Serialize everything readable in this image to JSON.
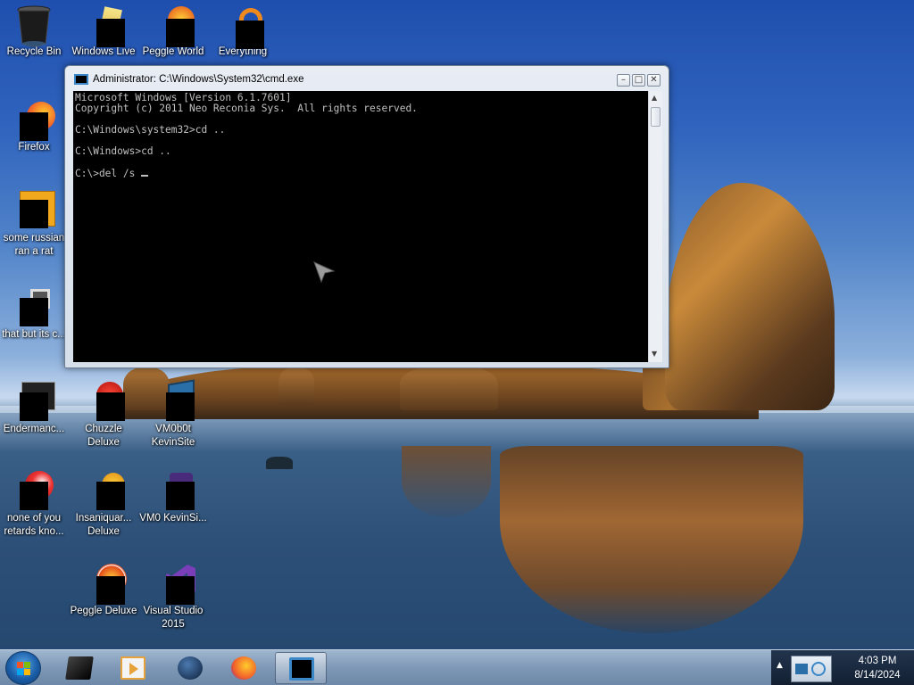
{
  "desktop": {
    "icons": [
      {
        "label": "Recycle Bin"
      },
      {
        "label": "Windows Live"
      },
      {
        "label": "Peggle World"
      },
      {
        "label": "Everything"
      },
      {
        "label": "Firefox"
      },
      {
        "label": "some russian ran a rat"
      },
      {
        "label": "that but its c..."
      },
      {
        "label": "Endermanc..."
      },
      {
        "label": "Chuzzle Deluxe"
      },
      {
        "label": "VM0b0t KevinSite"
      },
      {
        "label": "none of you retards kno..."
      },
      {
        "label": "Insaniquar... Deluxe"
      },
      {
        "label": "VM0 KevinSi..."
      },
      {
        "label": "Peggle Deluxe"
      },
      {
        "label": "Visual Studio 2015"
      }
    ]
  },
  "cmd_window": {
    "title": "Administrator: C:\\Windows\\System32\\cmd.exe",
    "lines": [
      "Microsoft Windows [Version 6.1.7601]",
      "Copyright (c) 2011 Neo Reconia Sys.  All rights reserved.",
      "",
      "C:\\Windows\\system32>cd ..",
      "",
      "C:\\Windows>cd ..",
      "",
      "C:\\>del /s "
    ],
    "text": "Microsoft Windows [Version 6.1.7601]\nCopyright (c) 2011 Neo Reconia Sys.  All rights reserved.\n\nC:\\Windows\\system32>cd ..\n\nC:\\Windows>cd ..\n\nC:\\>del /s "
  },
  "taskbar": {
    "clock_time": "4:03 PM",
    "clock_date": "8/14/2024"
  },
  "colors": {
    "console_bg": "#000000",
    "console_fg": "#c0c0c0",
    "taskbar": "#7e98b6"
  }
}
